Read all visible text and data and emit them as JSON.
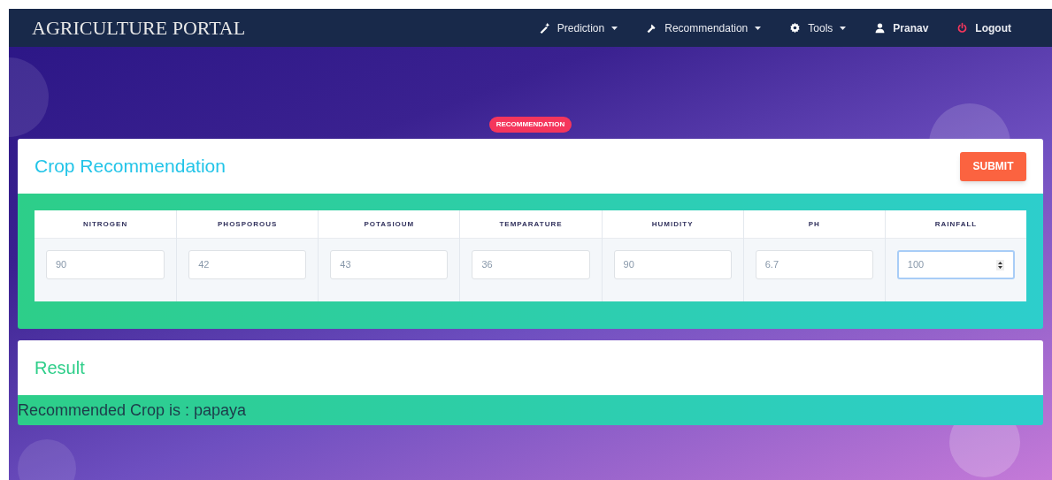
{
  "brand": "AGRICULTURE PORTAL",
  "nav": [
    {
      "label": "Prediction",
      "kind": "menu"
    },
    {
      "label": "Recommendation",
      "kind": "menu"
    },
    {
      "label": "Tools",
      "kind": "menu"
    },
    {
      "label": "Pranav",
      "kind": "link"
    },
    {
      "label": "Logout",
      "kind": "link"
    }
  ],
  "badge": "RECOMMENDATION",
  "form": {
    "title": "Crop Recommendation",
    "submit": "SUBMIT",
    "fields": [
      {
        "label": "NITROGEN",
        "value": "90",
        "focused": false
      },
      {
        "label": "PHOSPOROUS",
        "value": "42",
        "focused": false
      },
      {
        "label": "POTASIOUM",
        "value": "43",
        "focused": false
      },
      {
        "label": "TEMPARATURE",
        "value": "36",
        "focused": false
      },
      {
        "label": "HUMIDITY",
        "value": "90",
        "focused": false
      },
      {
        "label": "PH",
        "value": "6.7",
        "focused": false
      },
      {
        "label": "RAINFALL",
        "value": "100",
        "focused": true
      }
    ]
  },
  "result": {
    "title": "Result",
    "text": "Recommended Crop is : papaya"
  }
}
